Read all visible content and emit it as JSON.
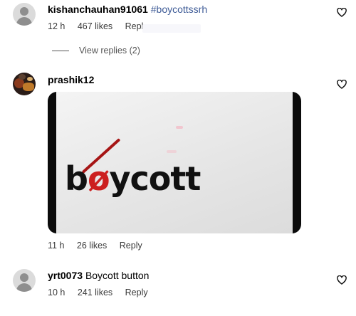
{
  "comments": [
    {
      "username": "kishanchauhan91061",
      "hashtag": "#boycottssrh",
      "time": "12 h",
      "likes": "467 likes",
      "reply": "Reply",
      "view_replies": "View replies (2)"
    },
    {
      "username": "prashik12",
      "media_logo_prefix": "b",
      "media_logo_o": "ø",
      "media_logo_suffix": "ycott",
      "time": "11 h",
      "likes": "26 likes",
      "reply": "Reply"
    },
    {
      "username": "yrt0073",
      "text": "Boycott button",
      "time": "10 h",
      "likes": "241 likes",
      "reply": "Reply"
    }
  ],
  "colors": {
    "hashtag": "#3d5a96",
    "meta_text": "#3a3a3a",
    "logo_accent": "#cc1f1f"
  },
  "icons": {
    "like": "heart-outline-icon",
    "avatar_default": "default-avatar-icon"
  }
}
